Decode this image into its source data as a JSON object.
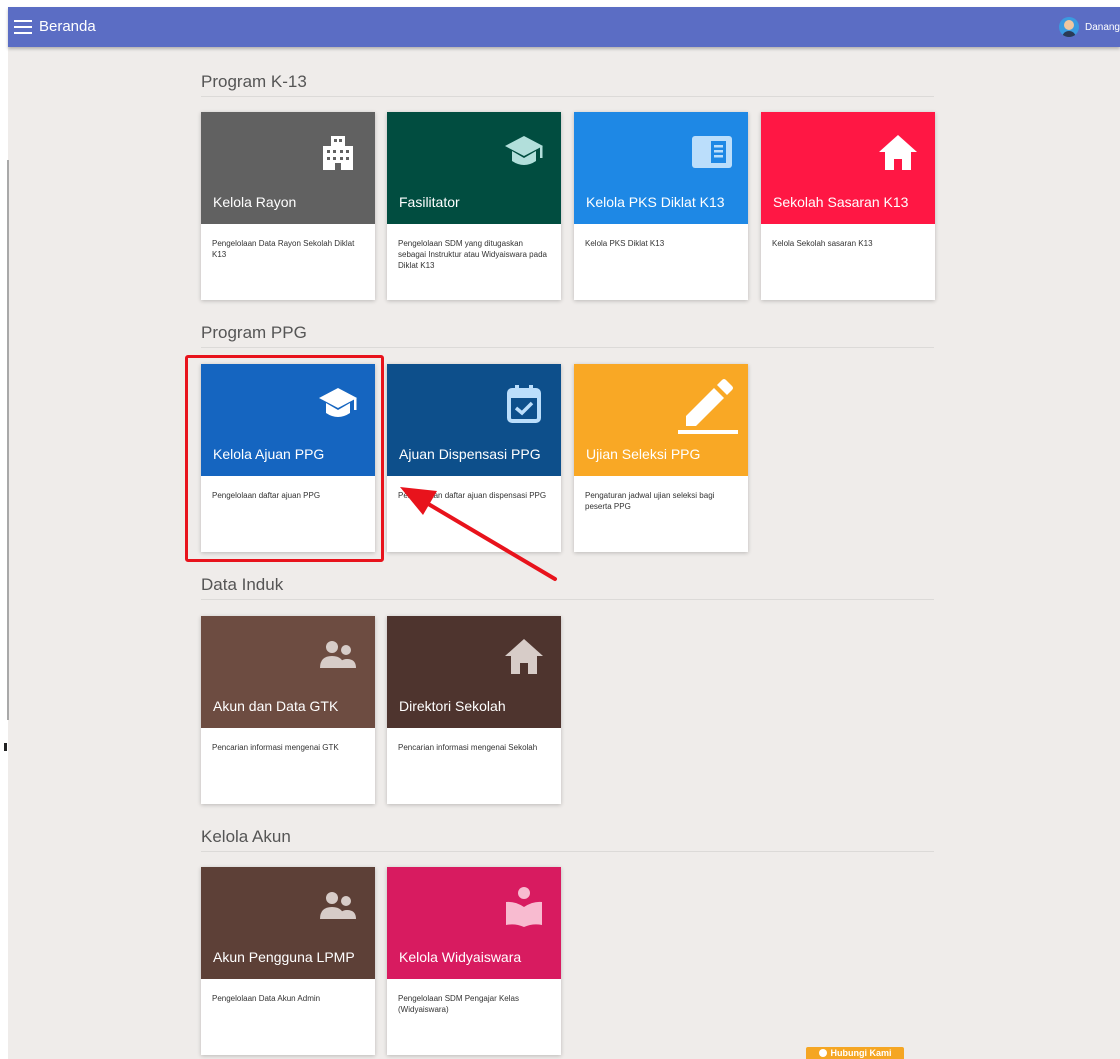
{
  "topbar": {
    "title": "Beranda",
    "user_name": "Danang"
  },
  "sections": [
    {
      "title": "Program K-13"
    },
    {
      "title": "Program PPG"
    },
    {
      "title": "Data Induk"
    },
    {
      "title": "Kelola Akun"
    }
  ],
  "cards": {
    "kelola_rayon": {
      "label": "Kelola Rayon",
      "desc": "Pengelolaan Data Rayon Sekolah Diklat K13",
      "icon": "building-icon",
      "color": "#616161"
    },
    "fasilitator": {
      "label": "Fasilitator",
      "desc": "Pengelolaan SDM yang ditugaskan sebagai Instruktur atau Widyaiswara pada Diklat K13",
      "icon": "graduation-cap-icon",
      "color": "#014d40"
    },
    "kelola_pks": {
      "label": "Kelola PKS Diklat K13",
      "desc": "Kelola PKS Diklat K13",
      "icon": "document-icon",
      "color": "#1e88e5"
    },
    "sekolah_sasaran": {
      "label": "Sekolah Sasaran K13",
      "desc": "Kelola Sekolah sasaran K13",
      "icon": "home-icon",
      "color": "#ff1744"
    },
    "kelola_ajuan_ppg": {
      "label": "Kelola Ajuan PPG",
      "desc": "Pengelolaan daftar ajuan PPG",
      "icon": "graduation-cap-icon",
      "color": "#1565c0"
    },
    "ajuan_dispensasi": {
      "label": "Ajuan Dispensasi PPG",
      "desc": "Pengelolaan daftar ajuan dispensasi PPG",
      "icon": "calendar-check-icon",
      "color": "#0d4f8b"
    },
    "ujian_seleksi": {
      "label": "Ujian Seleksi PPG",
      "desc": "Pengaturan jadwal ujian seleksi bagi peserta PPG",
      "icon": "pencil-icon",
      "color": "#f9a825"
    },
    "akun_data_gtk": {
      "label": "Akun dan Data GTK",
      "desc": "Pencarian informasi mengenai GTK",
      "icon": "people-icon",
      "color": "#6d4c41"
    },
    "direktori_sekolah": {
      "label": "Direktori Sekolah",
      "desc": "Pencarian informasi mengenai Sekolah",
      "icon": "home-icon",
      "color": "#4e342e"
    },
    "akun_pengguna_lpmp": {
      "label": "Akun Pengguna LPMP",
      "desc": "Pengelolaan Data Akun Admin",
      "icon": "people-icon",
      "color": "#5d4037"
    },
    "kelola_widyaiswara": {
      "label": "Kelola Widyaiswara",
      "desc": "Pengelolaan SDM Pengajar Kelas (Widyaiswara)",
      "icon": "reader-icon",
      "color": "#d81b60"
    }
  },
  "contact": {
    "label": "Hubungi Kami",
    "color": "#f5a623"
  },
  "annotation": {
    "highlight_color": "#e8131c"
  }
}
